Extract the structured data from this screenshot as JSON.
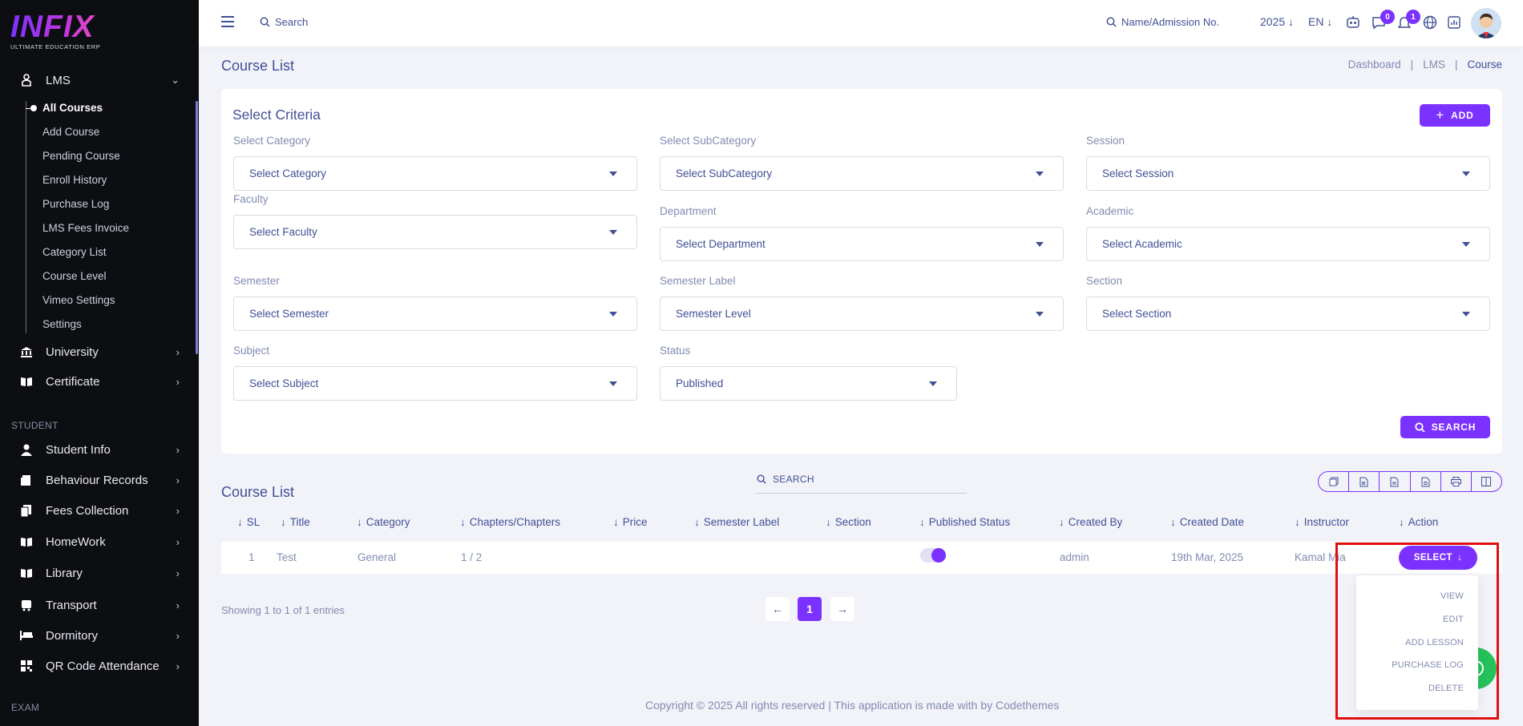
{
  "brand": {
    "name": "INFIX",
    "tagline": "ULTIMATE EDUCATION ERP"
  },
  "sidebar": {
    "lms": {
      "label": "LMS",
      "icon": "lms-icon"
    },
    "lms_items": [
      "All Courses",
      "Add Course",
      "Pending Course",
      "Enroll History",
      "Purchase Log",
      "LMS Fees Invoice",
      "Category List",
      "Course Level",
      "Vimeo Settings",
      "Settings"
    ],
    "modules": [
      {
        "label": "University",
        "icon": "university-icon"
      },
      {
        "label": "Certificate",
        "icon": "certificate-icon"
      }
    ],
    "student_section": "STUDENT",
    "student_items": [
      {
        "label": "Student Info",
        "icon": "student-icon"
      },
      {
        "label": "Behaviour Records",
        "icon": "behaviour-icon"
      },
      {
        "label": "Fees Collection",
        "icon": "fees-icon"
      },
      {
        "label": "HomeWork",
        "icon": "homework-icon"
      },
      {
        "label": "Library",
        "icon": "library-icon"
      },
      {
        "label": "Transport",
        "icon": "transport-icon"
      },
      {
        "label": "Dormitory",
        "icon": "dormitory-icon"
      },
      {
        "label": "QR Code Attendance",
        "icon": "qr-icon"
      }
    ],
    "exam_section": "EXAM"
  },
  "header": {
    "search_label": "Search",
    "admission_search": "Name/Admission No.",
    "year": "2025",
    "lang": "EN",
    "messages_count": "0",
    "notifications_count": "1"
  },
  "page": {
    "title": "Course List",
    "breadcrumb": [
      "Dashboard",
      "LMS",
      "Course"
    ]
  },
  "criteria": {
    "title": "Select Criteria",
    "add_label": "ADD",
    "search_label": "SEARCH",
    "fields": {
      "category": {
        "label": "Select Category",
        "value": "Select Category"
      },
      "subcategory": {
        "label": "Select SubCategory",
        "value": "Select SubCategory"
      },
      "session": {
        "label": "Session",
        "value": "Select Session"
      },
      "faculty": {
        "label": "Faculty",
        "value": "Select Faculty"
      },
      "department": {
        "label": "Department",
        "value": "Select Department"
      },
      "academic": {
        "label": "Academic",
        "value": "Select Academic"
      },
      "semester": {
        "label": "Semester",
        "value": "Select Semester"
      },
      "semester_label": {
        "label": "Semester Label",
        "value": "Semester Level"
      },
      "section": {
        "label": "Section",
        "value": "Select Section"
      },
      "subject": {
        "label": "Subject",
        "value": "Select Subject"
      },
      "status": {
        "label": "Status",
        "value": "Published"
      }
    }
  },
  "course_list": {
    "title": "Course List",
    "search_placeholder": "SEARCH",
    "columns": [
      "SL",
      "Title",
      "Category",
      "Chapters/Chapters",
      "Price",
      "Semester Label",
      "Section",
      "Published Status",
      "Created By",
      "Created Date",
      "Instructor",
      "Action"
    ],
    "rows": [
      {
        "sl": "1",
        "title": "Test",
        "category": "General",
        "chapters": "1 / 2",
        "price": "",
        "semester_label": "",
        "section": "",
        "published": true,
        "created_by": "admin",
        "created_date": "19th Mar, 2025",
        "instructor": "Kamal Mia"
      }
    ],
    "select_label": "SELECT",
    "actions": [
      "VIEW",
      "EDIT",
      "ADD LESSON",
      "PURCHASE LOG",
      "DELETE"
    ],
    "showing": "Showing 1 to 1 of 1 entries",
    "current_page": "1"
  },
  "footer": "Copyright © 2025 All rights reserved | This application is made with by Codethemes",
  "colors": {
    "accent": "#7c32ff",
    "sidebar_bg": "#0d0e12",
    "text": "#415094",
    "muted": "#828bb2",
    "highlight": "#e20f0f"
  }
}
